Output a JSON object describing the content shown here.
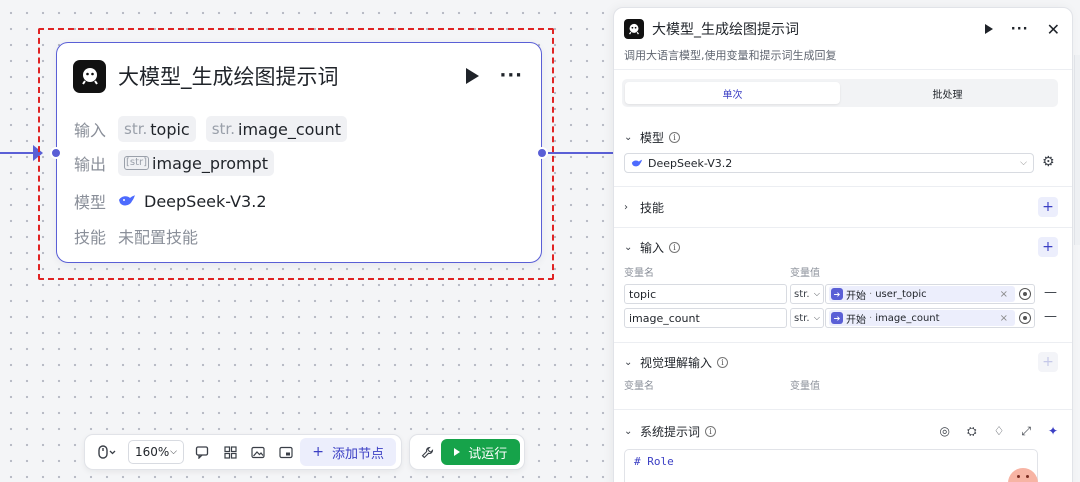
{
  "node": {
    "title": "大模型_生成绘图提示词",
    "input_label": "输入",
    "inputs": [
      {
        "type": "str.",
        "name": "topic"
      },
      {
        "type": "str.",
        "name": "image_count"
      }
    ],
    "output_label": "输出",
    "output": {
      "type": "[str]",
      "name": "image_prompt"
    },
    "model_label": "模型",
    "model": "DeepSeek-V3.2",
    "skills_label": "技能",
    "skills_value": "未配置技能"
  },
  "toolbar": {
    "zoom": "160%",
    "add_node": "添加节点",
    "run": "试运行"
  },
  "panel": {
    "title": "大模型_生成绘图提示词",
    "description": "调用大语言模型,使用变量和提示词生成回复",
    "tabs": [
      "单次",
      "批处理"
    ],
    "model_section": "模型",
    "model_value": "DeepSeek-V3.2",
    "skills_section": "技能",
    "input_section": "输入",
    "col_var_name": "变量名",
    "col_var_value": "变量值",
    "inputs": [
      {
        "name": "topic",
        "type": "str.",
        "source": "开始",
        "ref": "user_topic"
      },
      {
        "name": "image_count",
        "type": "str.",
        "source": "开始",
        "ref": "image_count"
      }
    ],
    "vision_section": "视觉理解输入",
    "vision_col_name": "变量名",
    "vision_col_value": "变量值",
    "system_prompt_section": "系统提示词",
    "prompt_first_line": "# Role"
  },
  "colors": {
    "accent": "#5a5fd6",
    "run_green": "#16a34a",
    "selection_red": "#e02424"
  }
}
